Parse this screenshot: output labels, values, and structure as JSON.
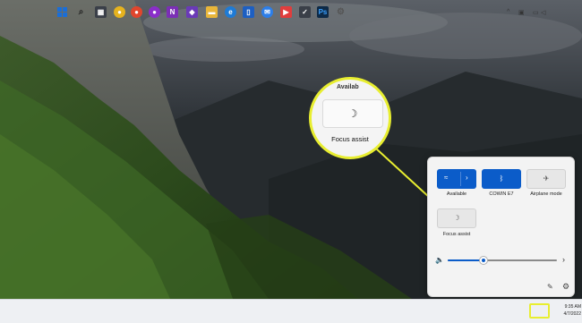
{
  "callout": {
    "top_text": "Availab",
    "tile_icon": "moon-icon",
    "label": "Focus assist"
  },
  "quick_settings": {
    "tiles": [
      {
        "name": "wifi",
        "label": "Available",
        "icon": "wifi-icon",
        "active": true
      },
      {
        "name": "bluetooth",
        "label": "COWIN E7",
        "icon": "bluetooth-icon",
        "active": true
      },
      {
        "name": "airplane",
        "label": "Airplane mode",
        "icon": "airplane-icon",
        "active": false
      },
      {
        "name": "focus-assist",
        "label": "Focus assist",
        "icon": "moon-icon",
        "active": false
      }
    ],
    "volume_level": 0.33
  },
  "taskbar": {
    "icons": [
      "windows-start-icon",
      "search-icon",
      "widgets-icon",
      "chrome-icon",
      "firefox-icon",
      "onenote-icon",
      "visual-studio-icon",
      "file-explorer-icon",
      "edge-icon",
      "phone-icon",
      "messenger-icon",
      "media-icon",
      "todo-icon",
      "photoshop-icon",
      "settings-icon"
    ],
    "time": "9:35 AM",
    "date": "4/7/2022"
  },
  "colors": {
    "accent": "#0b5cc9",
    "highlight": "#e8ee30"
  }
}
